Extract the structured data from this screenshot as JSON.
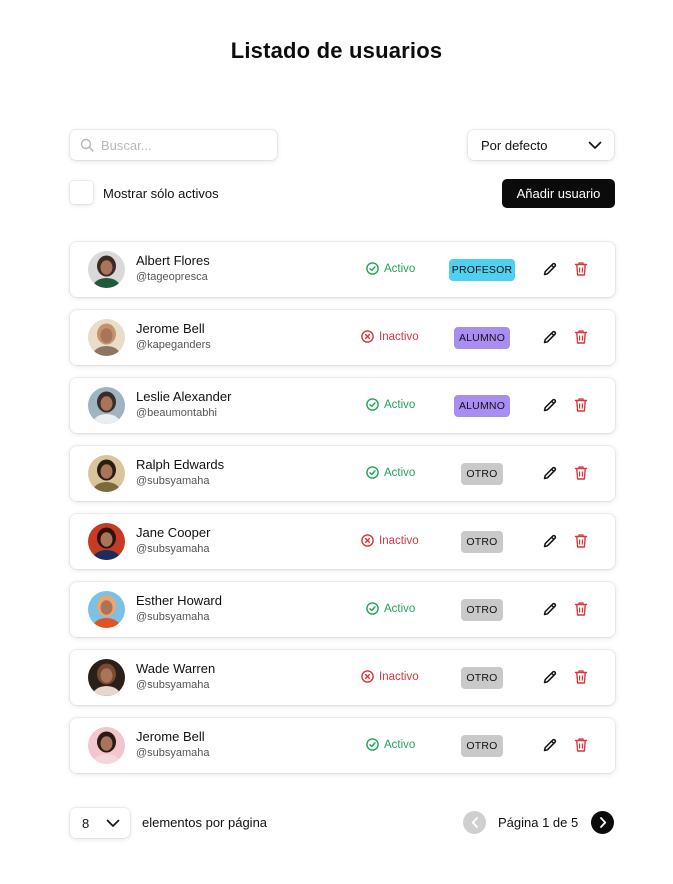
{
  "page": {
    "title": "Listado de usuarios"
  },
  "toolbar": {
    "search_placeholder": "Buscar...",
    "sort_selected": "Por defecto",
    "only_active_label": "Mostrar sólo activos",
    "only_active_checked": false,
    "add_user_label": "Añadir usuario"
  },
  "users": [
    {
      "name": "Albert Flores",
      "handle": "@tageopresca",
      "status": "Activo",
      "status_type": "active",
      "role": "PROFESOR",
      "role_type": "profesor",
      "avatar_colors": [
        "#d9d9d9",
        "#3b2a22",
        "#1f5a3a"
      ]
    },
    {
      "name": "Jerome Bell",
      "handle": "@kapeganders",
      "status": "Inactivo",
      "status_type": "inactive",
      "role": "ALUMNO",
      "role_type": "alumno",
      "avatar_colors": [
        "#e9dcc9",
        "#c4926c",
        "#8d7564"
      ]
    },
    {
      "name": "Leslie Alexander",
      "handle": "@beaumontabhi",
      "status": "Activo",
      "status_type": "active",
      "role": "ALUMNO",
      "role_type": "alumno",
      "avatar_colors": [
        "#9fb3c0",
        "#3a2d28",
        "#e9eef2"
      ]
    },
    {
      "name": "Ralph Edwards",
      "handle": "@subsyamaha",
      "status": "Activo",
      "status_type": "active",
      "role": "OTRO",
      "role_type": "otro",
      "avatar_colors": [
        "#d9c59b",
        "#2b1d14",
        "#7d6a3c"
      ]
    },
    {
      "name": "Jane Cooper",
      "handle": "@subsyamaha",
      "status": "Inactivo",
      "status_type": "inactive",
      "role": "OTRO",
      "role_type": "otro",
      "avatar_colors": [
        "#c73a23",
        "#2a1410",
        "#1b2e59"
      ]
    },
    {
      "name": "Esther Howard",
      "handle": "@subsyamaha",
      "status": "Activo",
      "status_type": "active",
      "role": "OTRO",
      "role_type": "otro",
      "avatar_colors": [
        "#7cc0e6",
        "#f0a46c",
        "#e2541f"
      ]
    },
    {
      "name": "Wade Warren",
      "handle": "@subsyamaha",
      "status": "Inactivo",
      "status_type": "inactive",
      "role": "OTRO",
      "role_type": "otro",
      "avatar_colors": [
        "#2a1f1a",
        "#7a4a2e",
        "#e8d7c8"
      ]
    },
    {
      "name": "Jerome Bell",
      "handle": "@subsyamaha",
      "status": "Activo",
      "status_type": "active",
      "role": "OTRO",
      "role_type": "otro",
      "avatar_colors": [
        "#f2c6cf",
        "#2b1a14",
        "#f4d6dc"
      ]
    }
  ],
  "pagination": {
    "per_page_value": "8",
    "per_page_label": "elementos por página",
    "page_text": "Página 1 de 5",
    "current_page": 1,
    "total_pages": 5
  },
  "icons": {
    "search": "search-icon",
    "dropdown": "chevron-down-icon",
    "active": "check-circle-icon",
    "inactive": "x-circle-icon",
    "edit": "pencil-icon",
    "delete": "trash-icon",
    "prev": "chevron-left-icon",
    "next": "chevron-right-icon"
  },
  "colors": {
    "active": "#22a35a",
    "inactive": "#d9363e",
    "profesor": "#4fd0f0",
    "alumno": "#a98ef2",
    "otro": "#c9c9c9",
    "delete": "#d9363e",
    "primary": "#0b0b0b"
  }
}
